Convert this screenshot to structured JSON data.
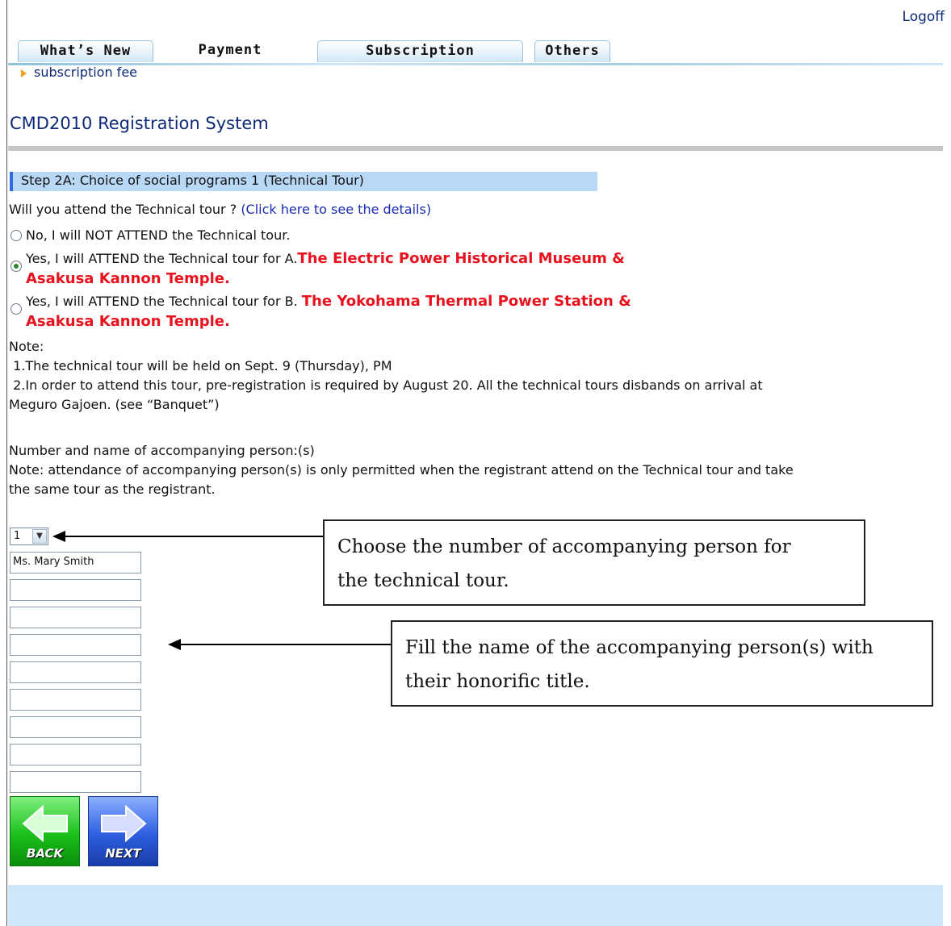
{
  "header": {
    "logoff": "Logoff"
  },
  "tabs": [
    {
      "label": "What’s New"
    },
    {
      "label": "Payment"
    },
    {
      "label": "Subscription"
    },
    {
      "label": "Others"
    }
  ],
  "breadcrumb": "subscription fee",
  "page_title": "CMD2010 Registration System",
  "step": {
    "title": "Step 2A: Choice of social programs 1 (Technical Tour)"
  },
  "question": {
    "text": "Will you attend the Technical tour ?",
    "link": "(Click here to see the details)"
  },
  "options": [
    {
      "text": "No, I will NOT ATTEND the Technical tour.",
      "checked": false
    },
    {
      "prefix": "Yes, I will ATTEND the Technical tour for A.",
      "highlight1": "The Electric Power Historical Museum &",
      "highlight2": "Asakusa Kannon Temple.",
      "checked": true
    },
    {
      "prefix": "Yes, I will ATTEND the Technical tour for B.",
      "highlight1": "The Yokohama Thermal Power Station &",
      "highlight2": "Asakusa Kannon Temple.",
      "checked": false
    }
  ],
  "notes": {
    "heading": "Note:",
    "item1": " 1.The technical tour will be held on Sept. 9 (Thursday), PM",
    "item2a": " 2.In order to attend this tour, pre-registration is required by August 20. All the technical tours disbands on arrival at",
    "item2b": "Meguro Gajoen. (see “Banquet”)"
  },
  "accompany": {
    "label": "Number and name of accompanying person:(s)",
    "note1": "Note: attendance of accompanying person(s) is only permitted when the registrant attend on the Technical tour and take",
    "note2": "the same tour as the registrant.",
    "count": "1",
    "names": [
      "Ms. Mary Smith",
      "",
      "",
      "",
      "",
      "",
      "",
      "",
      ""
    ]
  },
  "callouts": {
    "select_line1": "Choose the number of accompanying person for",
    "select_line2": "the technical tour.",
    "names_line1": "Fill the name of the accompanying person(s) with",
    "names_line2": "their honorific title."
  },
  "buttons": {
    "back": "BACK",
    "next": "NEXT"
  },
  "colors": {
    "title_blue": "#0e2a78",
    "highlight_red": "#e8121e",
    "step_bar": "#b8d8f5",
    "footer": "#cfe7f8"
  }
}
